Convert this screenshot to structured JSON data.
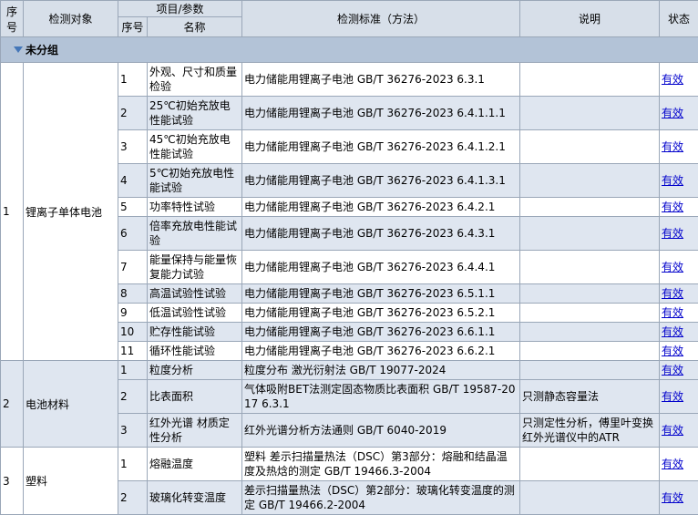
{
  "header": {
    "seq": "序号",
    "object": "检测对象",
    "item_param": "项目/参数",
    "sub_seq": "序号",
    "name": "名称",
    "standard": "检测标准（方法）",
    "note": "说明",
    "status": "状态"
  },
  "group": {
    "label": "未分组"
  },
  "categories": [
    {
      "seq": "1",
      "object": "锂离子单体电池",
      "rows": [
        {
          "no": "1",
          "name": "外观、尺寸和质量检验",
          "standard": "电力储能用锂离子电池 GB/T 36276-2023 6.3.1",
          "note": "",
          "status": "有效"
        },
        {
          "no": "2",
          "name": "25℃初始充放电性能试验",
          "standard": "电力储能用锂离子电池 GB/T 36276-2023 6.4.1.1.1",
          "note": "",
          "status": "有效"
        },
        {
          "no": "3",
          "name": "45℃初始充放电性能试验",
          "standard": "电力储能用锂离子电池 GB/T 36276-2023 6.4.1.2.1",
          "note": "",
          "status": "有效"
        },
        {
          "no": "4",
          "name": "5℃初始充放电性能试验",
          "standard": "电力储能用锂离子电池 GB/T 36276-2023 6.4.1.3.1",
          "note": "",
          "status": "有效"
        },
        {
          "no": "5",
          "name": "功率特性试验",
          "standard": "电力储能用锂离子电池 GB/T 36276-2023 6.4.2.1",
          "note": "",
          "status": "有效"
        },
        {
          "no": "6",
          "name": "倍率充放电性能试验",
          "standard": "电力储能用锂离子电池 GB/T 36276-2023 6.4.3.1",
          "note": "",
          "status": "有效"
        },
        {
          "no": "7",
          "name": "能量保持与能量恢复能力试验",
          "standard": "电力储能用锂离子电池 GB/T 36276-2023 6.4.4.1",
          "note": "",
          "status": "有效"
        },
        {
          "no": "8",
          "name": "高温试验性试验",
          "standard": "电力储能用锂离子电池 GB/T 36276-2023 6.5.1.1",
          "note": "",
          "status": "有效"
        },
        {
          "no": "9",
          "name": "低温试验性试验",
          "standard": "电力储能用锂离子电池 GB/T 36276-2023 6.5.2.1",
          "note": "",
          "status": "有效"
        },
        {
          "no": "10",
          "name": "贮存性能试验",
          "standard": "电力储能用锂离子电池 GB/T 36276-2023 6.6.1.1",
          "note": "",
          "status": "有效"
        },
        {
          "no": "11",
          "name": "循环性能试验",
          "standard": "电力储能用锂离子电池 GB/T 36276-2023 6.6.2.1",
          "note": "",
          "status": "有效"
        }
      ]
    },
    {
      "seq": "2",
      "object": "电池材料",
      "rows": [
        {
          "no": "1",
          "name": "粒度分析",
          "standard": "粒度分布 激光衍射法 GB/T 19077-2024",
          "note": "",
          "status": "有效"
        },
        {
          "no": "2",
          "name": "比表面积",
          "standard": "气体吸附BET法测定固态物质比表面积 GB/T 19587-2017 6.3.1",
          "note": "只测静态容量法",
          "status": "有效"
        },
        {
          "no": "3",
          "name": "红外光谱 材质定性分析",
          "standard": "红外光谱分析方法通则 GB/T 6040-2019",
          "note": "只测定性分析，傅里叶变换红外光谱仪中的ATR",
          "status": "有效"
        }
      ]
    },
    {
      "seq": "3",
      "object": "塑料",
      "rows": [
        {
          "no": "1",
          "name": "熔融温度",
          "standard": "塑料 差示扫描量热法（DSC）第3部分：熔融和结晶温度及热焓的测定 GB/T 19466.3-2004",
          "note": "",
          "status": "有效"
        },
        {
          "no": "2",
          "name": "玻璃化转变温度",
          "standard": "差示扫描量热法（DSC）第2部分：玻璃化转变温度的测定 GB/T 19466.2-2004",
          "note": "",
          "status": "有效"
        }
      ]
    }
  ]
}
